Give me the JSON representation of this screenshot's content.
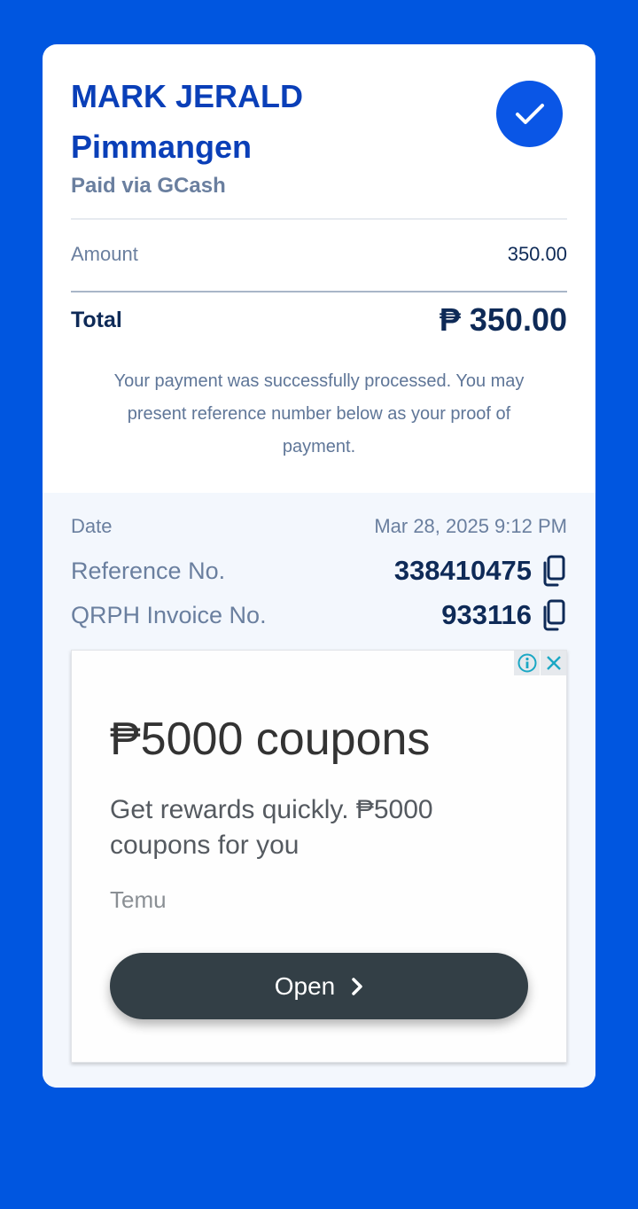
{
  "receipt": {
    "name_line1": "MARK JERALD",
    "name_line2": "Pimmangen",
    "paid_via": "Paid via GCash",
    "amount_label": "Amount",
    "amount_value": "350.00",
    "total_label": "Total",
    "total_value": "₱ 350.00",
    "message": "Your payment was successfully processed. You may present reference number below as your proof of payment."
  },
  "details": {
    "date_label": "Date",
    "date_value": "Mar 28, 2025 9:12 PM",
    "reference_label": "Reference No.",
    "reference_value": "338410475",
    "invoice_label": "QRPH Invoice No.",
    "invoice_value": "933116"
  },
  "ad": {
    "title": "₱5000 coupons",
    "description": "Get rewards quickly. ₱5000 coupons for you",
    "brand": "Temu",
    "button_label": "Open"
  },
  "colors": {
    "background": "#0056e0",
    "accent": "#0a56e6",
    "name": "#0a3fb8",
    "text_dark": "#0e2a57",
    "ad_button": "#333f46"
  },
  "icons": {
    "status": "check-icon",
    "copy": "copy-icon",
    "ad_info": "info-icon",
    "ad_close": "close-icon",
    "open_chevron": "chevron-right-icon"
  }
}
